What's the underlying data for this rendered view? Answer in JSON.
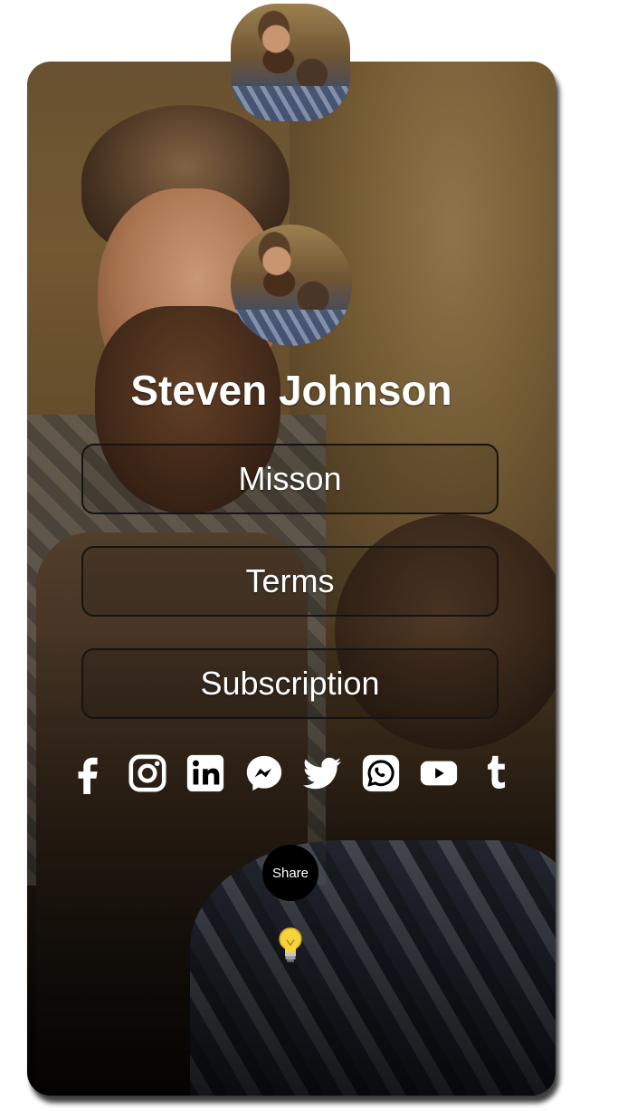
{
  "profile": {
    "name": "Steven Johnson"
  },
  "links": [
    {
      "label": "Misson"
    },
    {
      "label": "Terms"
    },
    {
      "label": "Subscription"
    }
  ],
  "socials": [
    {
      "icon": "facebook-icon"
    },
    {
      "icon": "instagram-icon"
    },
    {
      "icon": "linkedin-icon"
    },
    {
      "icon": "messenger-icon"
    },
    {
      "icon": "twitter-icon"
    },
    {
      "icon": "whatsapp-icon"
    },
    {
      "icon": "youtube-icon"
    },
    {
      "icon": "tumblr-icon"
    }
  ],
  "share": {
    "label": "Share"
  },
  "colors": {
    "text": "#ffffff",
    "button_border": "#141414",
    "share_bg": "#000000",
    "bulb": "#f5d33c"
  }
}
